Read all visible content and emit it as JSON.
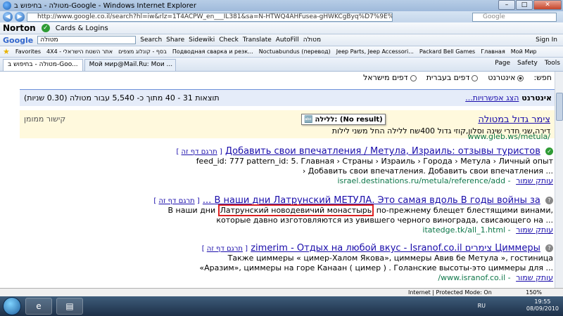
{
  "window": {
    "title": "מטולה - בחיפוש ב-Google - Windows Internet Explorer",
    "min": "–",
    "max": "□",
    "close": "✕"
  },
  "address": {
    "url": "http://www.google.co.il/search?hl=iw&rlz=1T4ACPW_en___IL381&sa=N-HTWQ4AHFusea-gHWKCgByq%D7%9E%D7%98%D7%95%D7%9C%D7%94&start=30",
    "search_engine": "Google"
  },
  "norton": {
    "logo": "Norton",
    "cards_logins": "Cards & Logins"
  },
  "google_toolbar": {
    "logo": "Google",
    "search_value": "מטולה",
    "search_btn": "Search",
    "share": "Share",
    "sidewiki": "Sidewiki",
    "check": "Check",
    "translate": "Translate",
    "autofill": "AutoFill",
    "extra_term": "מטולה",
    "signin": "Sign In"
  },
  "favorites": {
    "label": "Favorites",
    "items": [
      "4X4 - אתר השטח הישראלי",
      "בסף - קונלוג מצפים",
      "Подводная сварка и резк...",
      "Noctuabundus (перевод)",
      "Jeep Parts, Jeep Accessori...",
      "Packard Bell Games",
      "Главная",
      "Мой Мир"
    ]
  },
  "tabs": {
    "items": [
      "מטולה - בחיפוש ב-Goo...",
      "Мой мир@Mail.Ru: Мои ..."
    ],
    "page": "Page",
    "safety": "Safety",
    "tools": "Tools"
  },
  "search": {
    "filter_label": "חפש:",
    "filter_web": "אינטרנט",
    "filter_hebrew": "דפים בעברית",
    "filter_israel": "דפים מישראל",
    "section": "אינטרנט",
    "show_options": "הצג אפשרויות...",
    "results_info": "תוצאות 31 - 40 מתוך כ- 5,540 עבור מטולה (0.30 שניות)"
  },
  "ad": {
    "sponsored": "קישור ממומן",
    "title": "צימר גדול במטולה",
    "desc": "דירה,שני חדרי שינה וסלון,קוזי גדול 400שח ללילה החל משני לילות",
    "url": "www.gleb.ws/metula/"
  },
  "tooltip": {
    "text": "ללילה: (No result)"
  },
  "results": [
    {
      "title": "Добавить свои впечатления / Метула, Израиль: отзывы туристов",
      "translate": "תרגם דף זה",
      "snippet1": "feed_id: 777 pattern_id: 5. Главная › Страны › Израиль › Города › Метула › Личный опыт",
      "snippet2": "› Добавить свои впечатления. Добавить свои впечатления ...",
      "url": "israel.destinations.ru/metula/reference/add",
      "cache": "עותק שמור"
    },
    {
      "title": "В наши дни Латрунский МЕТУЛА. Это самая вдоль В годы войны за ...",
      "translate": "תרגם דף זה",
      "snippet_pre": "В наши дни",
      "snippet_hl": "Латрунский новодевичий монастырь",
      "snippet_post": "по-прежнему блещет блестящими винами,",
      "snippet2": "которые давно изготовляются из увившего черного винограда, свисающего на ...",
      "url": "itatedge.tk/all_1.html",
      "cache": "עותק שמור"
    },
    {
      "title": "Циммеры צימרים zimerim - Отдых на любой вкус - Isranof.co.il",
      "translate": "תרגם דף זה",
      "snippet1": "Также циммеры « цимер-Халом Якова», циммеры Авив бе Метула », гостиница",
      "snippet2": "«Аразим», циммеры на горе Канаан ( цимер ) . Голанские высоты-это циммеры для ...",
      "url": "www.isranof.co.il/",
      "cache": "עותק שמור"
    }
  ],
  "iestatus": {
    "zone": "Internet | Protected Mode: On",
    "zoom": "150%"
  },
  "taskbar": {
    "lang": "RU",
    "time": "19:55",
    "date": "08/09/2010"
  }
}
